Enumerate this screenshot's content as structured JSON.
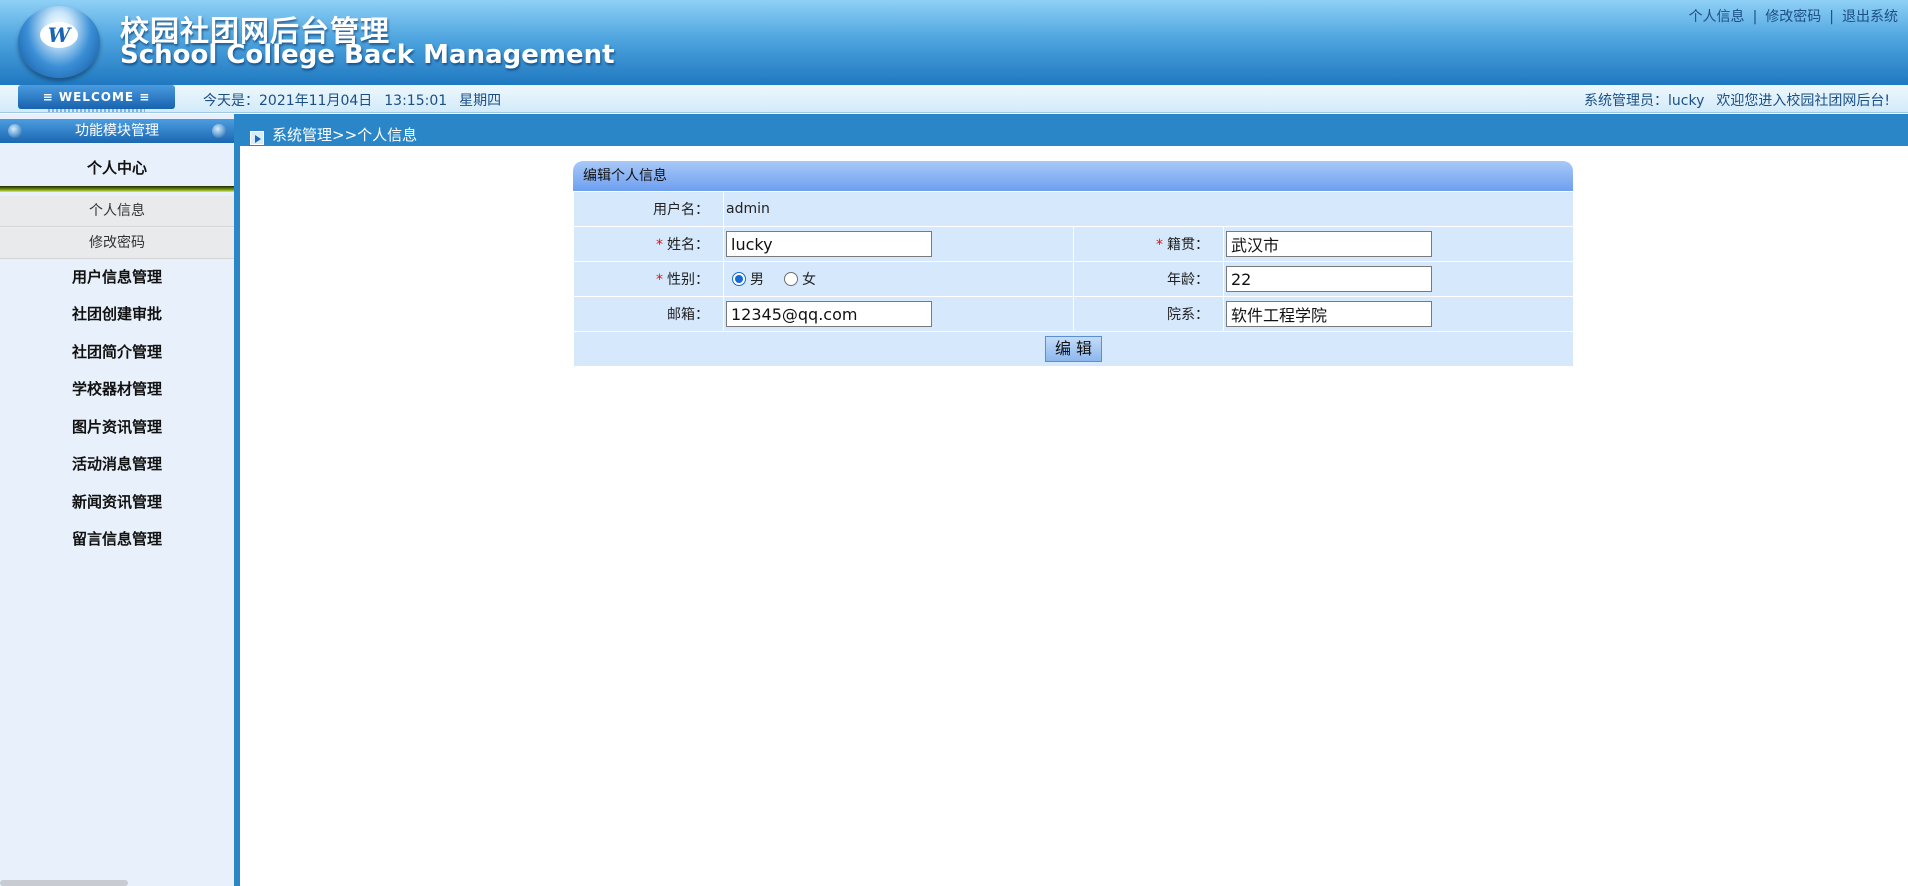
{
  "header": {
    "title_cn": "校园社团网后台管理",
    "title_en": "School College Back Management",
    "logo_letter": "W",
    "links": [
      "个人信息",
      "修改密码",
      "退出系统"
    ],
    "link_separator": "|"
  },
  "welcome_bar": {
    "badge": "≡ WELCOME ≡",
    "today_label": "今天是：2021年11月04日",
    "time": "13:15:01",
    "weekday": "星期四",
    "admin_label": "系统管理员：lucky",
    "greeting": "欢迎您进入校园社团网后台!"
  },
  "sidebar": {
    "title": "功能模块管理",
    "group_title": "个人中心",
    "sub_items": [
      "个人信息",
      "修改密码"
    ],
    "items": [
      "用户信息管理",
      "社团创建审批",
      "社团简介管理",
      "学校器材管理",
      "图片资讯管理",
      "活动消息管理",
      "新闻资讯管理",
      "留言信息管理"
    ]
  },
  "breadcrumb": "系统管理>>个人信息",
  "form": {
    "panel_title": "编辑个人信息",
    "username_label": "用户名：",
    "username_value": "admin",
    "name_label": "姓名：",
    "name_value": "lucky",
    "native_label": "籍贯：",
    "native_value": "武汉市",
    "gender_label": "性别：",
    "gender_options": [
      "男",
      "女"
    ],
    "gender_selected": "男",
    "age_label": "年龄：",
    "age_value": "22",
    "email_label": "邮箱：",
    "email_value": "12345@qq.com",
    "dept_label": "院系：",
    "dept_value": "软件工程学院",
    "required_mark": "*",
    "submit_label": "编 辑"
  },
  "colors": {
    "accent": "#2a86c6",
    "header_top": "#8fd0f6",
    "header_bottom": "#1f78c0",
    "form_cell": "#d6e8fb",
    "required": "#e01010"
  }
}
